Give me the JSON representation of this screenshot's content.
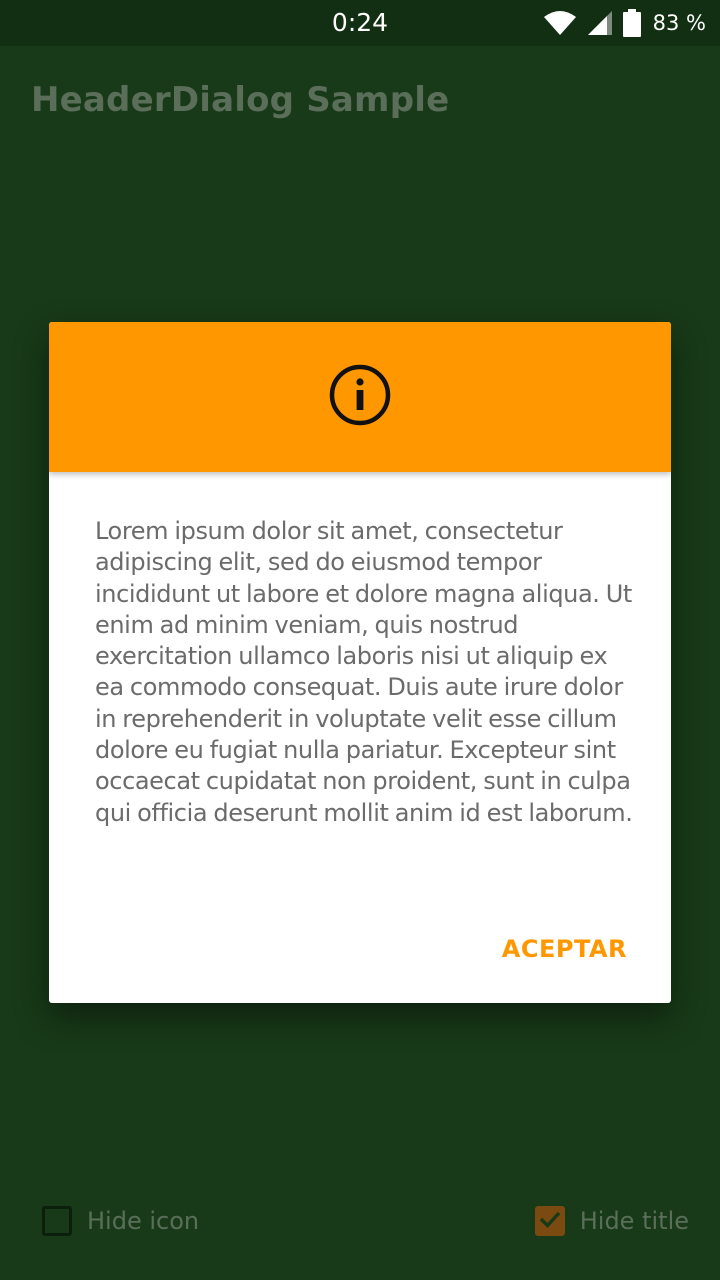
{
  "status_bar": {
    "time": "0:24",
    "battery_percent": "83 %",
    "icons": [
      "wifi-icon",
      "cell-signal-icon",
      "battery-icon"
    ]
  },
  "app_bar": {
    "title": "HeaderDialog Sample"
  },
  "dialog": {
    "header_icon": "info-icon",
    "message": "Lorem ipsum dolor sit amet, consectetur adipiscing elit, sed do eiusmod tempor incididunt ut labore et dolore magna aliqua. Ut enim ad minim veniam, quis nostrud exercitation ullamco laboris nisi ut aliquip ex ea commodo consequat. Duis aute irure dolor in reprehenderit in voluptate velit esse cillum dolore eu fugiat nulla pariatur. Excepteur sint occaecat cupidatat non proident, sunt in culpa qui officia deserunt mollit anim id est laborum.",
    "positive_button": "ACEPTAR"
  },
  "options": {
    "hide_icon": {
      "label": "Hide icon",
      "checked": false
    },
    "hide_title": {
      "label": "Hide title",
      "checked": true
    }
  },
  "colors": {
    "accent": "#ff9800",
    "background_dimmed": "#183a18",
    "status_bar": "#132f13",
    "dialog_surface": "#ffffff",
    "message_text": "#6b6b6b"
  }
}
